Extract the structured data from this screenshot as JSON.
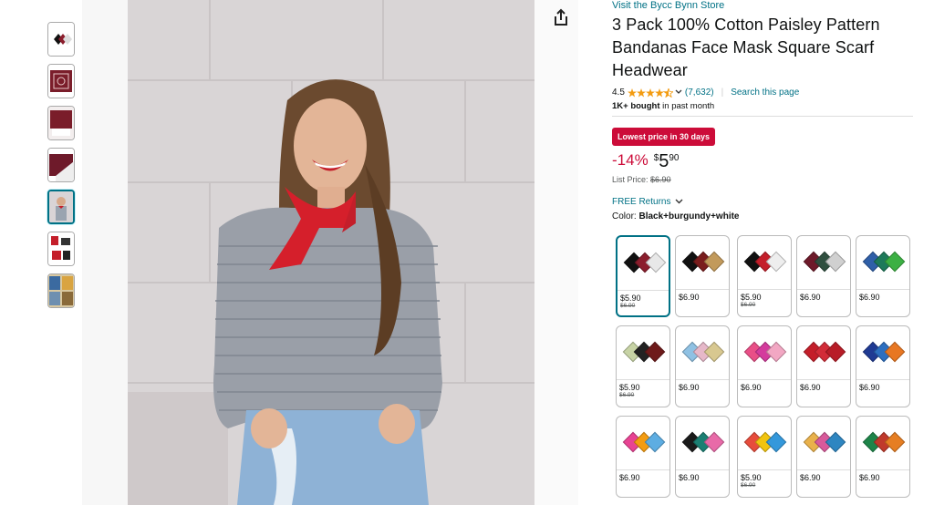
{
  "store_link": "Visit the Bycc Bynn Store",
  "title": "3 Pack 100% Cotton Paisley Pattern Bandanas Face Mask Square Scarf Headwear",
  "rating": {
    "value": "4.5",
    "count": "(7,632)",
    "stars": 4.5
  },
  "search_link": "Search this page",
  "bought": {
    "bold": "1K+ bought",
    "rest": "in past month"
  },
  "deal_badge": "Lowest price in 30 days",
  "price": {
    "discount": "-14%",
    "currency": "$",
    "whole": "5",
    "fraction": "90"
  },
  "list_price": {
    "label": "List Price:",
    "value": "$6.90"
  },
  "returns": "FREE Returns",
  "color": {
    "label": "Color:",
    "value": "Black+burgundy+white"
  },
  "swatches": [
    {
      "price": "$5.90",
      "old": "$6.90",
      "colors": [
        "#111",
        "#8b1e2d",
        "#e8e8e8"
      ]
    },
    {
      "price": "$6.90",
      "old": "",
      "colors": [
        "#111",
        "#7a1d1d",
        "#c29a5b"
      ]
    },
    {
      "price": "$5.90",
      "old": "$6.90",
      "colors": [
        "#111",
        "#c41e2a",
        "#eee"
      ]
    },
    {
      "price": "$6.90",
      "old": "",
      "colors": [
        "#6e1a2a",
        "#2f4f3f",
        "#d0d0d0"
      ]
    },
    {
      "price": "$6.90",
      "old": "",
      "colors": [
        "#2f5fa8",
        "#1e7a5a",
        "#3cb043"
      ]
    },
    {
      "price": "$5.90",
      "old": "$6.90",
      "colors": [
        "#c7d3a5",
        "#222",
        "#6e1a1a"
      ]
    },
    {
      "price": "$6.90",
      "old": "",
      "colors": [
        "#8fc1e3",
        "#e6b8c9",
        "#d8c890"
      ]
    },
    {
      "price": "$6.90",
      "old": "",
      "colors": [
        "#e94f87",
        "#d43b9d",
        "#f2a7c3"
      ]
    },
    {
      "price": "$6.90",
      "old": "",
      "colors": [
        "#c41e2a",
        "#d22c38",
        "#b81c27"
      ]
    },
    {
      "price": "$6.90",
      "old": "",
      "colors": [
        "#1f3a93",
        "#2d6fc0",
        "#e87722"
      ]
    },
    {
      "price": "$6.90",
      "old": "",
      "colors": [
        "#e84393",
        "#f39c12",
        "#5dade2"
      ]
    },
    {
      "price": "$6.90",
      "old": "",
      "colors": [
        "#1a1a1a",
        "#1b7f73",
        "#e86aa8"
      ]
    },
    {
      "price": "$5.90",
      "old": "$6.90",
      "colors": [
        "#e74c3c",
        "#f1c40f",
        "#3498db"
      ]
    },
    {
      "price": "$6.90",
      "old": "",
      "colors": [
        "#e9b14b",
        "#d85a9b",
        "#2e86c1"
      ]
    },
    {
      "price": "$6.90",
      "old": "",
      "colors": [
        "#1e8449",
        "#c0392b",
        "#e67e22"
      ]
    }
  ]
}
